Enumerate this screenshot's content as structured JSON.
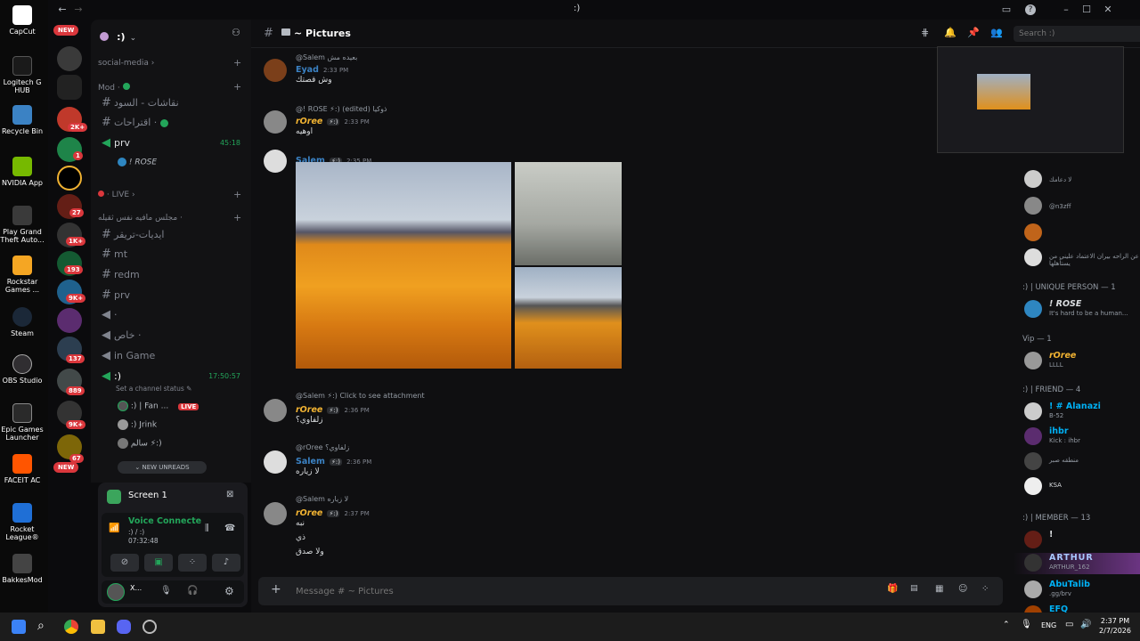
{
  "desktop_icons": [
    {
      "label": "CapCut",
      "icon": "capcut-icon",
      "color": "#ffffff"
    },
    {
      "label": "Logitech G HUB",
      "icon": "logitech-icon",
      "color": "#0f0f0f"
    },
    {
      "label": "Recycle Bin",
      "icon": "recycle-bin-icon",
      "color": "#3b82c4"
    },
    {
      "label": "NVIDIA App",
      "icon": "nvidia-icon",
      "color": "#76b900"
    },
    {
      "label": "Play Grand Theft Auto...",
      "icon": "gta-icon",
      "color": "#2a2a2a"
    },
    {
      "label": "Rockstar Games ...",
      "icon": "rockstar-icon",
      "color": "#f5a623"
    },
    {
      "label": "Steam",
      "icon": "steam-icon",
      "color": "#1b2838"
    },
    {
      "label": "OBS Studio",
      "icon": "obs-icon",
      "color": "#302e31"
    },
    {
      "label": "Epic Games Launcher",
      "icon": "epic-icon",
      "color": "#2a2a2a"
    },
    {
      "label": "FACEIT AC",
      "icon": "faceit-icon",
      "color": "#ff5500"
    },
    {
      "label": "Rocket League®",
      "icon": "rocket-league-icon",
      "color": "#1f6fd6"
    },
    {
      "label": "BakkesMod",
      "icon": "bakkesmod-icon",
      "color": "#222222"
    }
  ],
  "title_bar": {
    "title": ":)"
  },
  "servers": {
    "new_top": "NEW",
    "new_bottom": "NEW",
    "badges": [
      "2K+",
      "1",
      "27",
      "1K+",
      "193",
      "9K+",
      "137",
      "889",
      "9K+",
      "67"
    ]
  },
  "server": {
    "name": ":)"
  },
  "channels": [
    {
      "type": "category",
      "label": "social-media ›"
    },
    {
      "type": "category",
      "label": "Mod ·"
    },
    {
      "type": "text",
      "label": "نقاشات - السود"
    },
    {
      "type": "text",
      "label": "اقتراحات ·"
    },
    {
      "type": "voice",
      "label": "prv",
      "timer": "45:18"
    },
    {
      "type": "voice-user",
      "label": "! ROSE"
    },
    {
      "type": "category",
      "label": "· LIVE ›"
    },
    {
      "type": "category",
      "label": "مجلس مافيه نفس ثقيله ·"
    },
    {
      "type": "text",
      "label": "ايديات-تريقر"
    },
    {
      "type": "text",
      "label": "mt"
    },
    {
      "type": "text",
      "label": "redm"
    },
    {
      "type": "text",
      "label": "prv"
    },
    {
      "type": "voice",
      "label": "·"
    },
    {
      "type": "voice",
      "label": "خاص ·"
    },
    {
      "type": "voice",
      "label": "in Game"
    },
    {
      "type": "voice",
      "label": ":)",
      "timer": "17:50:57"
    },
    {
      "type": "status",
      "label": "Set a channel status"
    },
    {
      "type": "voice-user",
      "label": ":) | Fan ...",
      "live": "LIVE"
    },
    {
      "type": "voice-user",
      "label": ":) Jrink"
    },
    {
      "type": "voice-user",
      "label": "سالم ⚡:)"
    }
  ],
  "new_unreads": "NEW UNREADS",
  "panel": {
    "screen_title": "Screen 1",
    "voice_status": "Voice Connecte",
    "voice_channel": ":) / :)",
    "voice_time": "07:32:48",
    "user_name": "X..."
  },
  "chat": {
    "channel_name": "~ Pictures",
    "search_placeholder": "Search :)",
    "message_placeholder": "Message # ~ Pictures",
    "messages": [
      {
        "reply": "@Salem بعيده مش",
        "name": "Eyad",
        "name_color": "#3b82c4",
        "time": "2:33 PM",
        "text": "وش قصتك"
      },
      {
        "reply": "@! ROSE ⚡:) (edited) ذوكيا",
        "name": "rOree",
        "name_color": "#f0b232",
        "time": "2:33 PM",
        "text": "اوهيه"
      },
      {
        "reply": "",
        "name": "Salem",
        "name_color": "#3b82c4",
        "time": "2:35 PM",
        "text": ""
      },
      {
        "reply": "@Salem ⚡:) Click to see attachment",
        "name": "rOree",
        "name_color": "#f0b232",
        "time": "2:36 PM",
        "text": "زلفاوي؟"
      },
      {
        "reply": "@rOree زلفاوي؟",
        "name": "Salem",
        "name_color": "#3b82c4",
        "time": "2:36 PM",
        "text": "لا زياره"
      },
      {
        "reply": "@Salem لا زياره",
        "name": "rOree",
        "name_color": "#f0b232",
        "time": "2:37 PM",
        "text": "نبه"
      },
      {
        "reply": "",
        "name": "",
        "name_color": "",
        "time": "",
        "text": "ذي"
      },
      {
        "reply": "",
        "name": "",
        "name_color": "",
        "time": "",
        "text": "ولا صدق"
      }
    ]
  },
  "members": {
    "groups": [
      {
        "label": ":) | UNIQUE PERSON — 1"
      },
      {
        "label": "Vip — 1"
      },
      {
        "label": ":) | FRIEND — 4"
      },
      {
        "label": ":) | MEMBER — 13"
      }
    ],
    "list": [
      {
        "name": "! ROSE",
        "status": "It's hard to be a human...",
        "color": "#dbdee1"
      },
      {
        "name": "rOree",
        "status": "LLLL",
        "color": "#f0b232"
      },
      {
        "name": "! # Alanazi",
        "status": "B-52",
        "color": "#00b0f4"
      },
      {
        "name": "ihbr",
        "status": "Kick : ihbr",
        "color": "#00b0f4"
      },
      {
        "name": "",
        "status": "منطقه صبر",
        "color": "#dbdee1"
      },
      {
        "name": "",
        "status": "KSA",
        "color": "#da373c"
      },
      {
        "name": "!",
        "status": "",
        "color": "#dbdee1"
      },
      {
        "name": "ARTHUR",
        "status": "ARTHUR_162",
        "color": "#a8c8ff"
      },
      {
        "name": "AbuTalib",
        "status": ".gg/brv",
        "color": "#00b0f4"
      },
      {
        "name": "EFQ",
        "status": "",
        "color": "#00b0f4"
      }
    ],
    "top_statuses": [
      "لا دعامك",
      "@n3zff",
      "وشند عن الراحه بيران الاعتماد عليني من يستأهلها"
    ]
  },
  "taskbar": {
    "lang": "ENG",
    "time": "2:37 PM",
    "date": "2/7/2026"
  }
}
